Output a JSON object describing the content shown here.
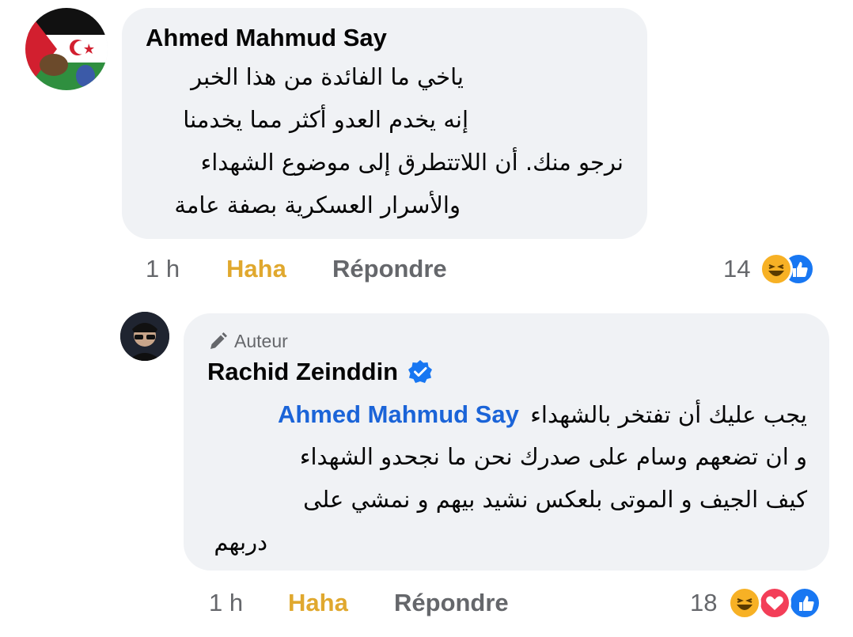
{
  "comments": [
    {
      "author": "Ahmed Mahmud Say",
      "lines": [
        "ياخي ما الفائدة من هذا الخبر",
        "إنه يخدم العدو أكثر مما يخدمنا",
        "نرجو منك. أن اللاتتطرق إلى موضوع الشهداء",
        "والأسرار العسكرية بصفة عامة"
      ],
      "time": "1 h",
      "react_label": "Haha",
      "reply_label": "Répondre",
      "reaction_count": "14",
      "reactions": [
        "haha-reaction-icon",
        "like-reaction-icon"
      ]
    },
    {
      "badge": "Auteur",
      "author": "Rachid Zeinddin",
      "verified": true,
      "mention": "Ahmed Mahmud Say",
      "first_line_text": "يجب عليك أن تفتخر بالشهداء",
      "lines": [
        "و ان تضعهم وسام على صدرك نحن ما نجحدو الشهداء",
        "كيف الجيف و الموتى بلعكس نشيد بيهم و نمشي على",
        "دربهم"
      ],
      "time": "1 h",
      "react_label": "Haha",
      "reply_label": "Répondre",
      "reaction_count": "18",
      "reactions": [
        "haha-reaction-icon",
        "love-reaction-icon",
        "like-reaction-icon"
      ]
    }
  ],
  "colors": {
    "bubble": "#f0f2f5",
    "haha": "#e0a82e",
    "mention": "#1b64d8",
    "like": "#1877f2",
    "love": "#f33e58",
    "secondary_text": "#65676b"
  }
}
